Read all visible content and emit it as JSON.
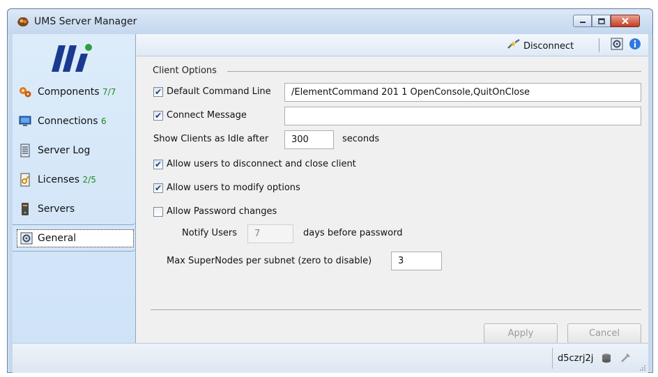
{
  "window": {
    "title": "UMS Server Manager",
    "accent": "#c6d9ee",
    "icon": "ums-app-icon"
  },
  "sidebar": {
    "items": [
      {
        "label": "Components",
        "count": "7/7",
        "icon": "gears-icon"
      },
      {
        "label": "Connections",
        "count": "6",
        "icon": "monitor-icon"
      },
      {
        "label": "Server Log",
        "count": "",
        "icon": "log-document-icon"
      },
      {
        "label": "Licenses",
        "count": "2/5",
        "icon": "license-key-icon"
      },
      {
        "label": "Servers",
        "count": "",
        "icon": "server-tower-icon"
      },
      {
        "label": "General",
        "count": "",
        "icon": "settings-gear-icon",
        "selected": true
      }
    ]
  },
  "toolbar": {
    "disconnect_label": "Disconnect",
    "icons": [
      "disconnect-plug-icon",
      "settings-icon",
      "info-icon"
    ]
  },
  "client_options": {
    "group_title": "Client Options",
    "default_command_line": {
      "label": "Default Command Line",
      "checked": true,
      "value": "/ElementCommand 201 1 OpenConsole,QuitOnClose"
    },
    "connect_message": {
      "label": "Connect Message",
      "checked": true,
      "value": ""
    },
    "idle": {
      "label": "Show Clients as Idle after",
      "value": "300",
      "suffix": "seconds"
    },
    "allow_disconnect": {
      "label": "Allow users to disconnect and close client",
      "checked": true
    },
    "allow_modify": {
      "label": "Allow users to modify options",
      "checked": true
    },
    "allow_password": {
      "label": "Allow Password changes",
      "checked": false
    },
    "notify": {
      "label": "Notify Users",
      "value": "7",
      "suffix": "days before password"
    },
    "supernodes": {
      "label": "Max SuperNodes per subnet (zero to disable)",
      "value": "3"
    }
  },
  "buttons": {
    "apply": "Apply",
    "cancel": "Cancel"
  },
  "statusbar": {
    "host": "d5czrj2j",
    "icons": [
      "database-icon",
      "connection-plug-icon"
    ]
  }
}
